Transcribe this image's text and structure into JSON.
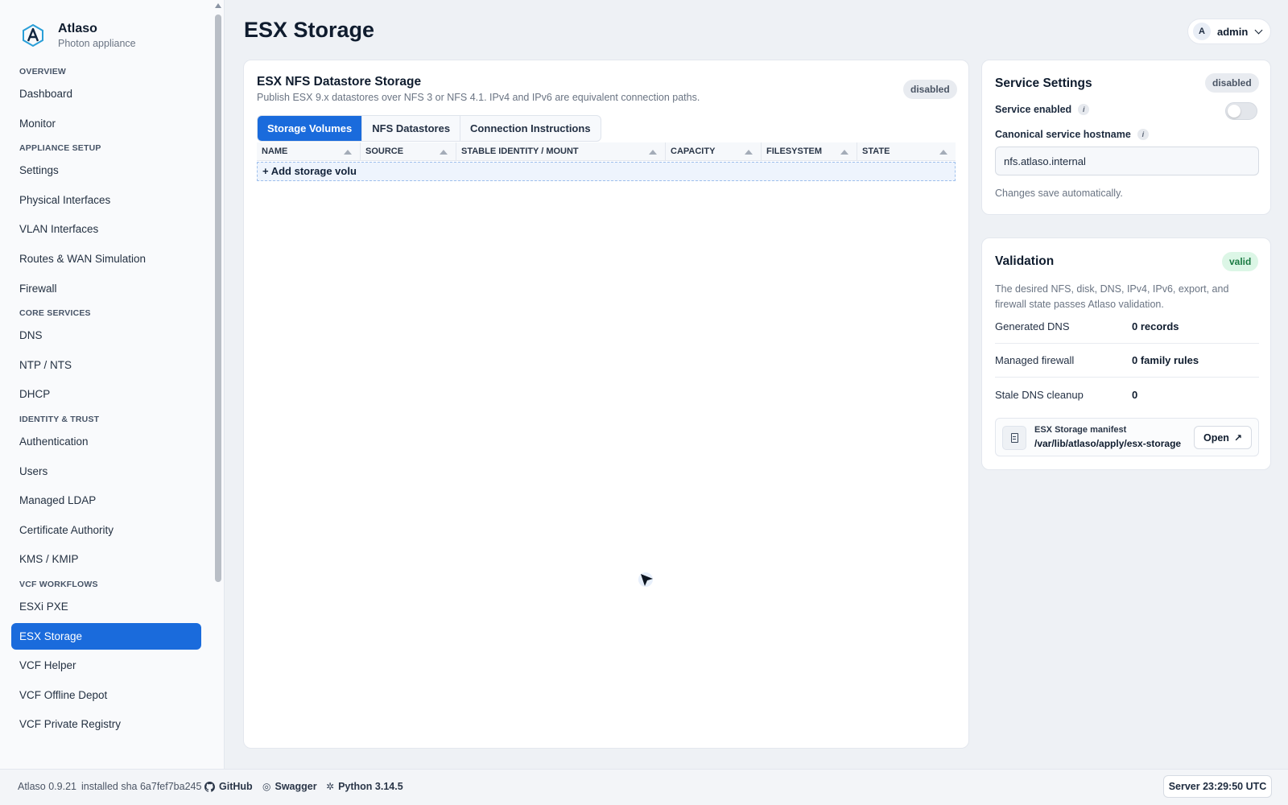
{
  "brand": {
    "name": "Atlaso",
    "subtitle": "Photon appliance"
  },
  "sidebar": {
    "sections": [
      {
        "title": "OVERVIEW",
        "items": [
          "Dashboard",
          "Monitor"
        ]
      },
      {
        "title": "APPLIANCE SETUP",
        "items": [
          "Settings",
          "Physical Interfaces",
          "VLAN Interfaces",
          "Routes & WAN Simulation",
          "Firewall"
        ]
      },
      {
        "title": "CORE SERVICES",
        "items": [
          "DNS",
          "NTP / NTS",
          "DHCP"
        ]
      },
      {
        "title": "IDENTITY & TRUST",
        "items": [
          "Authentication",
          "Users",
          "Managed LDAP",
          "Certificate Authority",
          "KMS / KMIP"
        ]
      },
      {
        "title": "VCF WORKFLOWS",
        "items": [
          "ESXi PXE",
          "ESX Storage",
          "VCF Helper",
          "VCF Offline Depot",
          "VCF Private Registry"
        ]
      }
    ],
    "active_item": "ESX Storage"
  },
  "header": {
    "title": "ESX Storage",
    "user_initial": "A",
    "user_name": "admin"
  },
  "main_card": {
    "title": "ESX NFS Datastore Storage",
    "subtitle": "Publish ESX 9.x datastores over NFS 3 or NFS 4.1. IPv4 and IPv6 are equivalent connection paths.",
    "status": "disabled",
    "tabs": [
      "Storage Volumes",
      "NFS Datastores",
      "Connection Instructions"
    ],
    "active_tab": "Storage Volumes",
    "columns": [
      "NAME",
      "SOURCE",
      "STABLE IDENTITY / MOUNT",
      "CAPACITY",
      "FILESYSTEM",
      "STATE"
    ],
    "add_label": "+ Add storage volu"
  },
  "service_settings": {
    "title": "Service Settings",
    "status": "disabled",
    "enabled_label": "Service enabled",
    "enabled": false,
    "hostname_label": "Canonical service hostname",
    "hostname_value": "nfs.atlaso.internal",
    "hint": "Changes save automatically."
  },
  "validation": {
    "title": "Validation",
    "status": "valid",
    "description": "The desired NFS, disk, DNS, IPv4, IPv6, export, and firewall state passes Atlaso validation.",
    "rows": [
      {
        "key": "Generated DNS",
        "value": "0 records"
      },
      {
        "key": "Managed firewall",
        "value": "0 family rules"
      },
      {
        "key": "Stale DNS cleanup",
        "value": "0"
      }
    ],
    "manifest_title": "ESX Storage manifest",
    "manifest_path": "/var/lib/atlaso/apply/esx-storage",
    "open_label": "Open"
  },
  "footer": {
    "version": "Atlaso 0.9.21",
    "installed": "installed sha 6a7fef7ba245",
    "github": "GitHub",
    "swagger": "Swagger",
    "python": "Python 3.14.5",
    "server_time": "Server 23:29:50 UTC"
  },
  "colors": {
    "accent": "#1a6bdc",
    "valid": "#1a7a42"
  }
}
